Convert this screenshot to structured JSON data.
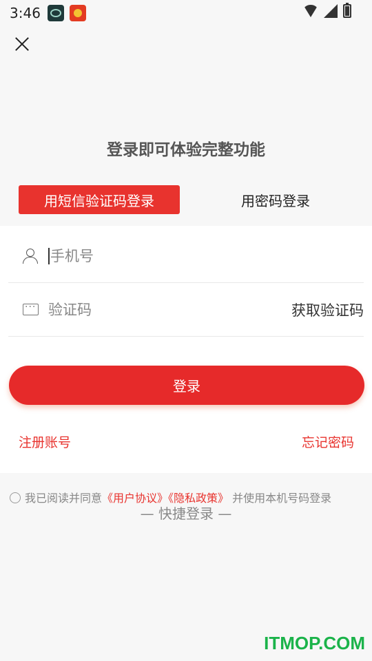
{
  "status_bar": {
    "time": "3:46"
  },
  "title": "登录即可体验完整功能",
  "tabs": {
    "sms": "用短信验证码登录",
    "password": "用密码登录"
  },
  "form": {
    "phone_placeholder": "手机号",
    "code_placeholder": "验证码",
    "get_code": "获取验证码",
    "login": "登录"
  },
  "links": {
    "register": "注册账号",
    "forgot": "忘记密码"
  },
  "agreement": {
    "prefix": "我已阅读并同意",
    "user_agreement": "《用户协议》",
    "privacy_policy": "《隐私政策》",
    "suffix": " 并使用本机号码登录"
  },
  "quick_login": "— 快捷登录 —",
  "watermark": "ITMOP.COM",
  "colors": {
    "accent": "#e8332e",
    "watermark": "#1bb34a"
  }
}
